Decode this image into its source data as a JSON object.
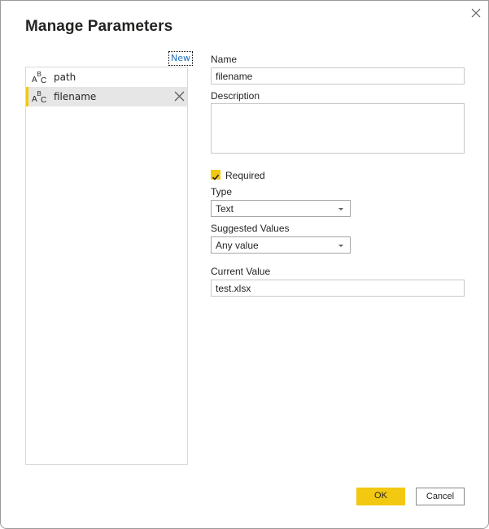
{
  "dialog": {
    "title": "Manage Parameters",
    "close_icon": "close-icon"
  },
  "parameters_list": {
    "new_label": "New",
    "items": [
      {
        "name": "path",
        "type_icon": "abc-text-type-icon",
        "selected": false
      },
      {
        "name": "filename",
        "type_icon": "abc-text-type-icon",
        "selected": true
      }
    ],
    "remove_icon": "x-remove-icon"
  },
  "form": {
    "name_label": "Name",
    "name_value": "filename",
    "description_label": "Description",
    "description_value": "",
    "required_label": "Required",
    "required_checked": true,
    "type_label": "Type",
    "type_value": "Text",
    "suggested_values_label": "Suggested Values",
    "suggested_values_value": "Any value",
    "current_value_label": "Current Value",
    "current_value_value": "test.xlsx"
  },
  "footer": {
    "ok_label": "OK",
    "cancel_label": "Cancel"
  },
  "colors": {
    "accent": "#f2c811",
    "link": "#1f6fbf",
    "selected_row": "#e6e6e6"
  }
}
